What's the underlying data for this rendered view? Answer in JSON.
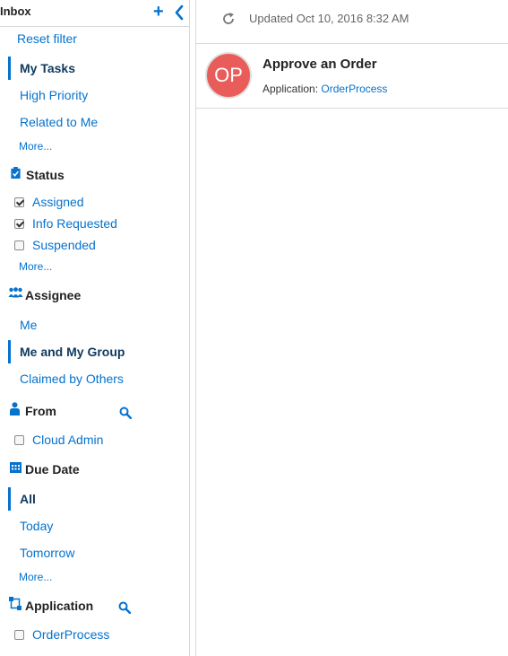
{
  "sidebar": {
    "title": "Inbox",
    "reset_filter": "Reset filter",
    "views": [
      {
        "label": "My Tasks",
        "selected": true
      },
      {
        "label": "High Priority",
        "selected": false
      },
      {
        "label": "Related to Me",
        "selected": false
      }
    ],
    "views_more": "More...",
    "status": {
      "title": "Status",
      "icon": "clipboard-check-icon",
      "options": [
        {
          "label": "Assigned",
          "checked": true
        },
        {
          "label": "Info Requested",
          "checked": true
        },
        {
          "label": "Suspended",
          "checked": false
        }
      ],
      "more": "More..."
    },
    "assignee": {
      "title": "Assignee",
      "icon": "group-icon",
      "options": [
        {
          "label": "Me",
          "selected": false
        },
        {
          "label": "Me and My Group",
          "selected": true
        },
        {
          "label": "Claimed by Others",
          "selected": false
        }
      ]
    },
    "from": {
      "title": "From",
      "icon": "person-icon",
      "options": [
        {
          "label": "Cloud Admin",
          "checked": false
        }
      ]
    },
    "due_date": {
      "title": "Due Date",
      "icon": "calendar-icon",
      "options": [
        {
          "label": "All",
          "selected": true
        },
        {
          "label": "Today",
          "selected": false
        },
        {
          "label": "Tomorrow",
          "selected": false
        }
      ],
      "more": "More..."
    },
    "application": {
      "title": "Application",
      "icon": "application-icon",
      "options": [
        {
          "label": "OrderProcess",
          "checked": false
        }
      ]
    }
  },
  "main": {
    "updated_text": "Updated Oct 10, 2016 8:32 AM",
    "tasks": [
      {
        "initials": "OP",
        "avatar_color": "#e85d5a",
        "title": "Approve an Order",
        "meta_label": "Application:",
        "meta_value": "OrderProcess"
      }
    ]
  },
  "colors": {
    "accent": "#0572ce",
    "selected_text": "#0f3a5f",
    "border": "#d6d9dc"
  }
}
